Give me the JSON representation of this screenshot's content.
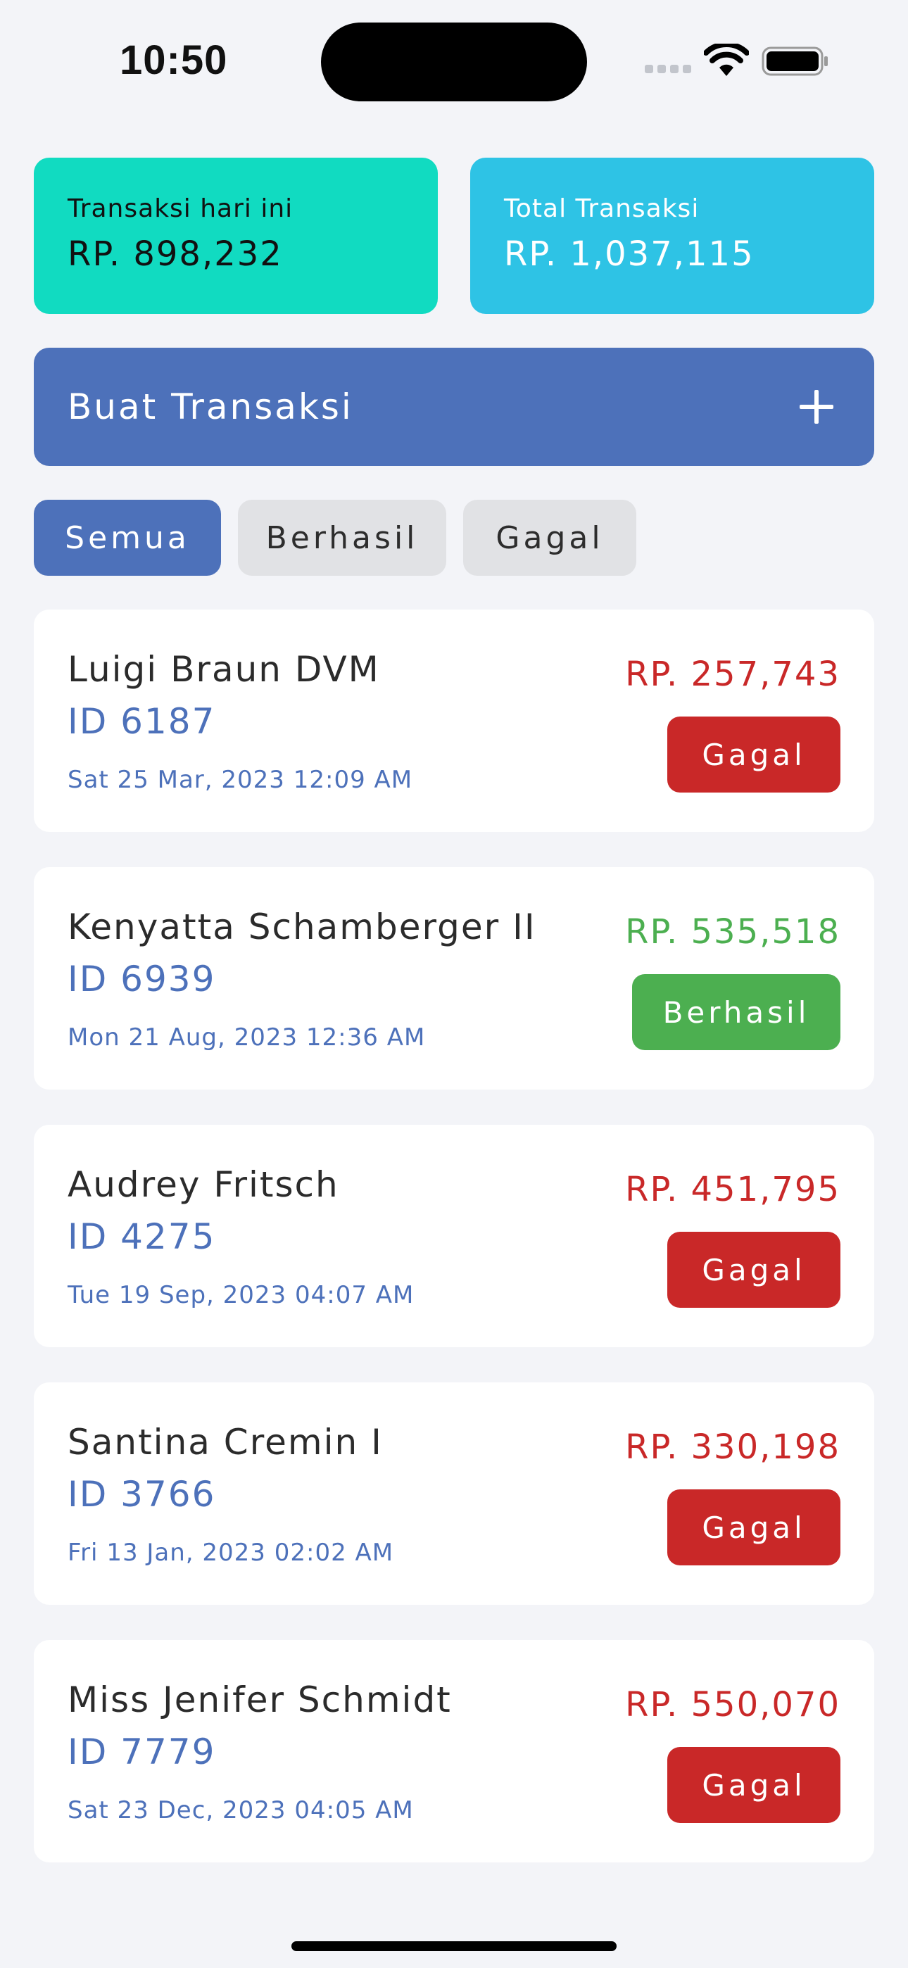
{
  "status_bar": {
    "time": "10:50",
    "icons": [
      "signal-icon",
      "wifi-icon",
      "battery-icon"
    ]
  },
  "summary": {
    "today_label": "Transaksi hari ini",
    "today_value": "RP. 898,232",
    "total_label": "Total Transaksi",
    "total_value": "RP. 1,037,115"
  },
  "create": {
    "label": "Buat Transaksi",
    "icon": "plus-icon"
  },
  "filters": {
    "all": "Semua",
    "success": "Berhasil",
    "failed": "Gagal",
    "selected": "Semua"
  },
  "transactions": [
    {
      "name": "Luigi Braun DVM",
      "id": "ID 6187",
      "date": "Sat 25 Mar, 2023 12:09 AM",
      "amount": "RP. 257,743",
      "status": "Gagal"
    },
    {
      "name": "Kenyatta Schamberger II",
      "id": "ID 6939",
      "date": "Mon 21 Aug, 2023 12:36 AM",
      "amount": "RP. 535,518",
      "status": "Berhasil"
    },
    {
      "name": "Audrey Fritsch",
      "id": "ID 4275",
      "date": "Tue 19 Sep, 2023 04:07 AM",
      "amount": "RP. 451,795",
      "status": "Gagal"
    },
    {
      "name": "Santina Cremin I",
      "id": "ID 3766",
      "date": "Fri 13 Jan, 2023 02:02 AM",
      "amount": "RP. 330,198",
      "status": "Gagal"
    },
    {
      "name": "Miss Jenifer Schmidt",
      "id": "ID 7779",
      "date": "Sat 23 Dec, 2023 04:05 AM",
      "amount": "RP. 550,070",
      "status": "Gagal"
    }
  ],
  "colors": {
    "primary": "#4d71ba",
    "teal_card": "#11dbc1",
    "cyan_card": "#2ec3e5",
    "failed": "#c92828",
    "success": "#4caf50",
    "background": "#f3f4f8"
  }
}
